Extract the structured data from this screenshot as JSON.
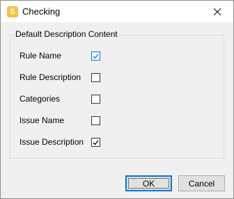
{
  "window": {
    "title": "Checking",
    "app_icon_letter": "S"
  },
  "group": {
    "title": "Default Description Content",
    "options": [
      {
        "label": "Rule Name",
        "checked": true
      },
      {
        "label": "Rule Description",
        "checked": false
      },
      {
        "label": "Categories",
        "checked": false
      },
      {
        "label": "Issue Name",
        "checked": false
      },
      {
        "label": "Issue Description",
        "checked": true
      }
    ]
  },
  "buttons": {
    "ok_label": "OK",
    "cancel_label": "Cancel"
  }
}
